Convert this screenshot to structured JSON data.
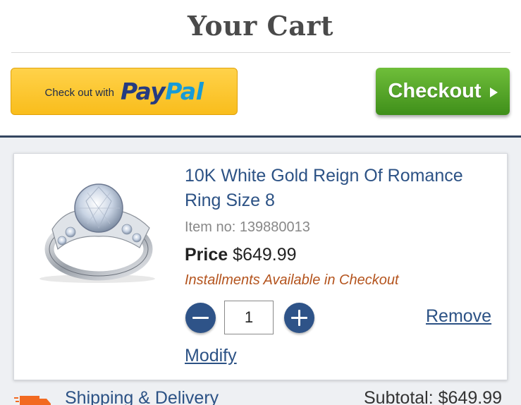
{
  "header": {
    "title": "Your Cart"
  },
  "actions": {
    "paypal_prefix": "Check out with",
    "paypal_logo_pay": "Pay",
    "paypal_logo_pal": "Pal",
    "checkout_label": "Checkout",
    "checkout_icon": "play-triangle-icon"
  },
  "cart_item": {
    "name": "10K White Gold Reign Of Romance Ring Size 8",
    "item_number": "Item no: 139880013",
    "price_label": "Price",
    "price": "$649.99",
    "installments": "Installments Available in Checkout",
    "quantity": "1",
    "remove_label": "Remove",
    "modify_label": "Modify",
    "image_icon": "ring-image"
  },
  "footer": {
    "shipping_label": "Shipping & Delivery",
    "shipping_icon": "delivery-truck-icon",
    "subtotal": "Subtotal: $649.99"
  },
  "colors": {
    "brand_navy": "#2e5388",
    "link": "#2c5285",
    "checkout_green": "#4f9f24",
    "paypal_yellow": "#fcc439",
    "installments_orange": "#b4541e",
    "shipping_orange": "#f26a21"
  }
}
